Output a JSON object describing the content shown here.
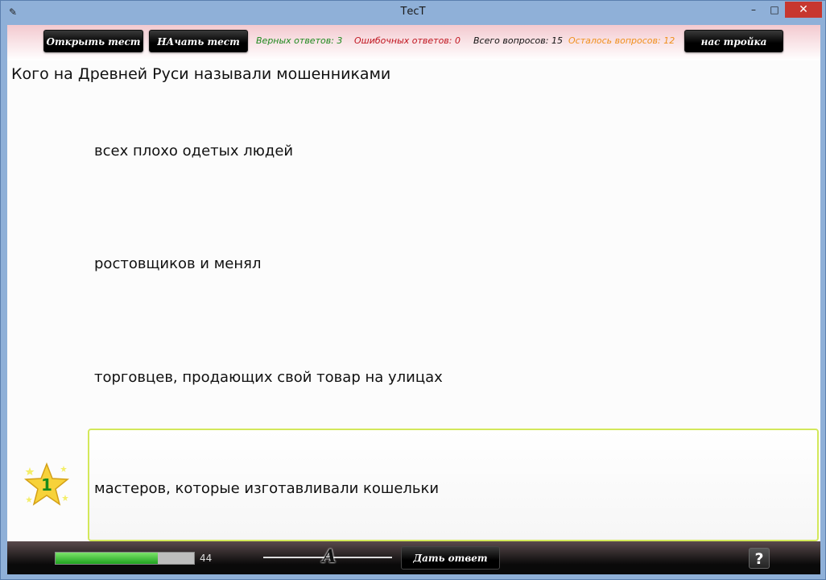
{
  "window": {
    "title": "ТесТ",
    "min_glyph": "–",
    "max_glyph": "□",
    "close_glyph": "✕"
  },
  "toolbar": {
    "open_label": "Открыть тест",
    "start_label": "НАчать тест",
    "settings_label": "нас тройка"
  },
  "stats": {
    "correct": "Верных ответов: 3",
    "wrong": "Ошибочных ответов: 0",
    "total": "Всего вопросов: 15",
    "remaining": "Осталось вопросов: 12",
    "colors": {
      "correct": "#1f8a1f",
      "wrong": "#c0141e",
      "total": "#111111",
      "remaining": "#f0901c"
    }
  },
  "question": {
    "text": "Кого на Древней Руси называли мошенниками"
  },
  "answers": [
    {
      "text": "всех плохо одетых людей",
      "selected": false
    },
    {
      "text": "ростовщиков и менял",
      "selected": false
    },
    {
      "text": "торговцев, продающих свой товар на улицах",
      "selected": false
    },
    {
      "text": "мастеров, которые изготавливали кошельки",
      "selected": true
    }
  ],
  "badge": {
    "icon": "star-icon",
    "number": "1"
  },
  "bottom": {
    "progress_value": "44",
    "progress_fraction": 0.74,
    "font_slider_glyph": "A",
    "answer_label": "Дать ответ",
    "help_label": "?"
  }
}
